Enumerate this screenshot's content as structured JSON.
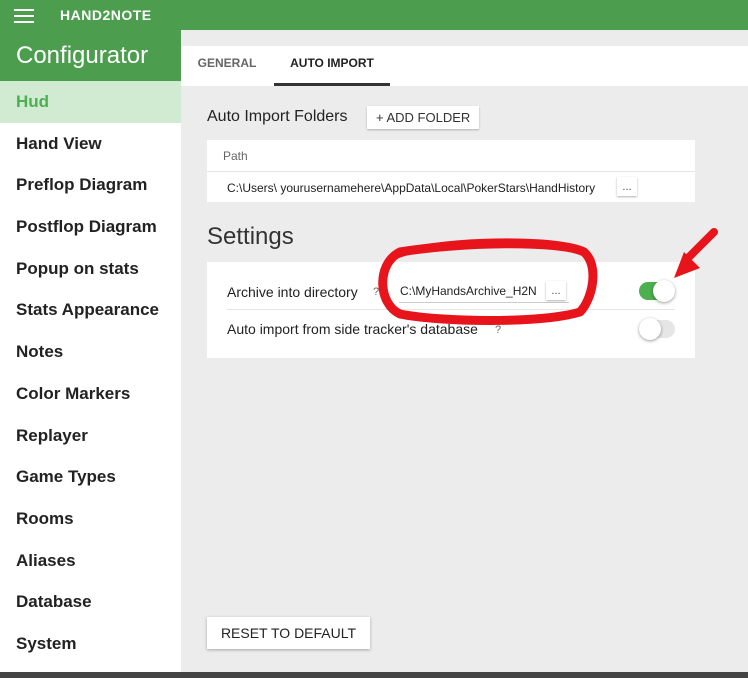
{
  "app": {
    "title": "HAND2NOTE"
  },
  "sidebar": {
    "header": "Configurator",
    "items": [
      {
        "label": "Hud",
        "active": true
      },
      {
        "label": "Hand View"
      },
      {
        "label": "Preflop Diagram"
      },
      {
        "label": "Postflop Diagram"
      },
      {
        "label": "Popup on stats"
      },
      {
        "label": "Stats Appearance"
      },
      {
        "label": "Notes"
      },
      {
        "label": "Color Markers"
      },
      {
        "label": "Replayer"
      },
      {
        "label": "Game Types"
      },
      {
        "label": "Rooms"
      },
      {
        "label": "Aliases"
      },
      {
        "label": "Database"
      },
      {
        "label": "System"
      }
    ]
  },
  "tabs": [
    {
      "label": "GENERAL",
      "active": false
    },
    {
      "label": "AUTO IMPORT",
      "active": true
    }
  ],
  "auto_import": {
    "folders_label": "Auto Import Folders",
    "add_folder_label": "+ ADD FOLDER",
    "path_header": "Path",
    "folders": [
      {
        "path": "C:\\Users\\ yourusernamehere\\AppData\\Local\\PokerStars\\HandHistory",
        "browse_label": "..."
      }
    ]
  },
  "settings": {
    "title": "Settings",
    "archive": {
      "label": "Archive into directory",
      "help": "?",
      "value": "C:\\MyHandsArchive_H2N",
      "browse_label": "...",
      "enabled": true
    },
    "side_tracker": {
      "label": "Auto import from side tracker's database",
      "help": "?",
      "enabled": false
    }
  },
  "reset_label": "RESET TO DEFAULT",
  "colors": {
    "brand_green": "#4c9e4e",
    "active_item_bg": "#d1ead2",
    "toggle_on": "#4caf50",
    "annotation_red": "#e8141c"
  }
}
